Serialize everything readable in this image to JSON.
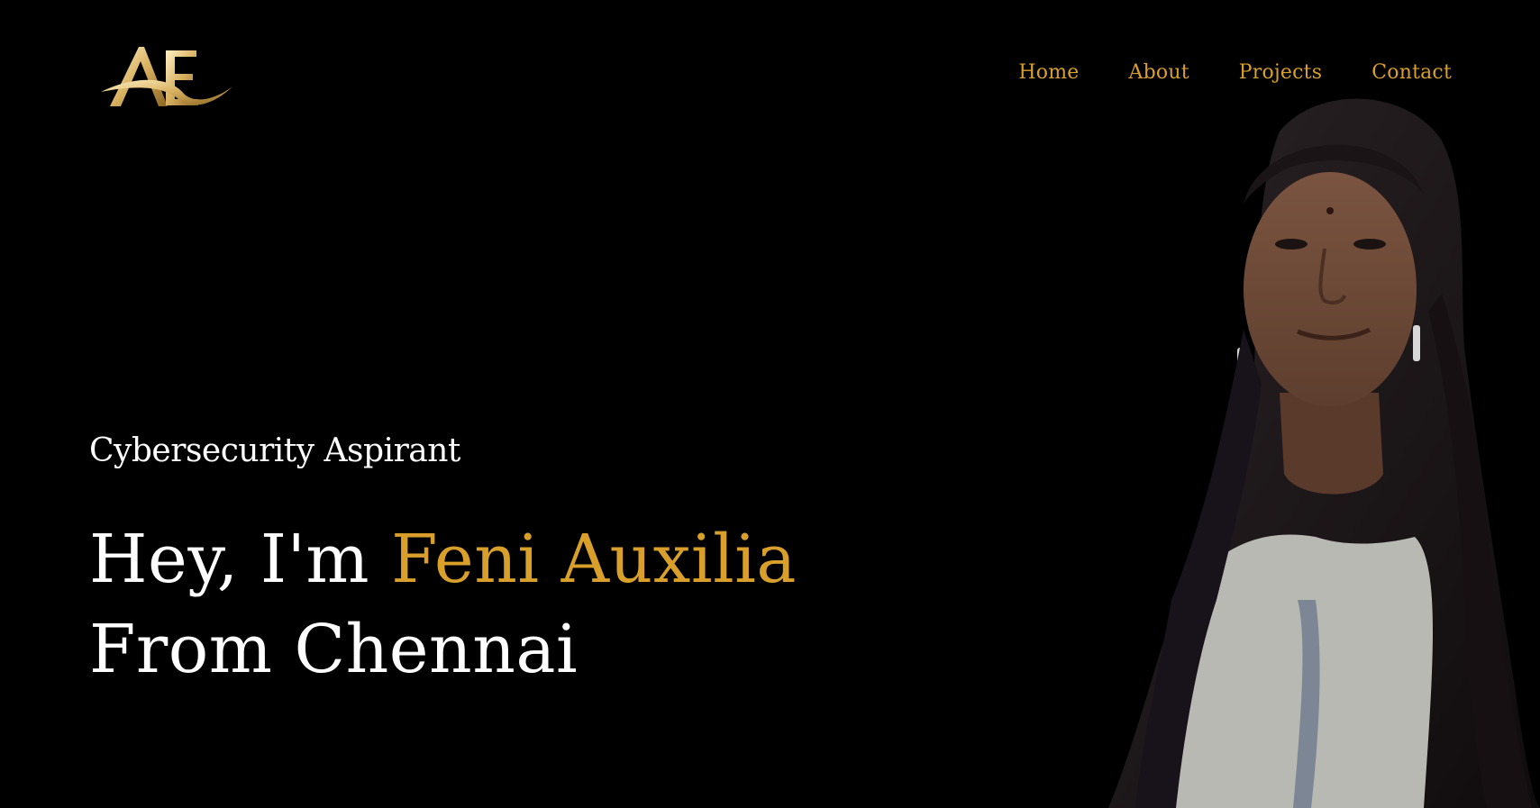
{
  "logo": {
    "text": "AE",
    "icon": "ae-monogram-logo"
  },
  "nav": {
    "items": [
      {
        "label": "Home"
      },
      {
        "label": "About"
      },
      {
        "label": "Projects"
      },
      {
        "label": "Contact"
      }
    ]
  },
  "hero": {
    "role": "Cybersecurity Aspirant",
    "greeting_prefix": "Hey, I'm ",
    "name": "Feni Auxilia",
    "location_line": "From Chennai"
  },
  "portrait": {
    "icon": "portrait-photo"
  },
  "colors": {
    "background": "#000000",
    "accent": "#d8a02a",
    "text": "#ffffff"
  }
}
